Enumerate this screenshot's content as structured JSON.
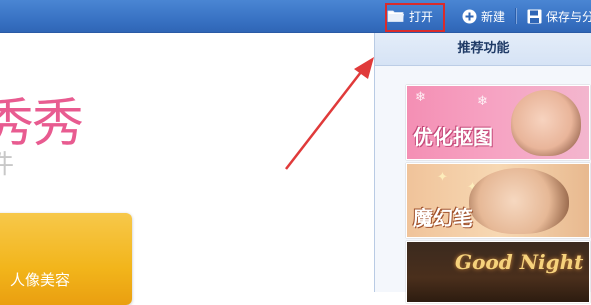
{
  "toolbar": {
    "open_label": "打开",
    "new_label": "新建",
    "save_label": "保存与分"
  },
  "canvas": {
    "brand_title": "秀秀",
    "brand_subtitle": "件",
    "portrait_tile_label": "人像美容"
  },
  "panel": {
    "title": "推荐功能",
    "cards": [
      {
        "label": "优化抠图"
      },
      {
        "label": "魔幻笔"
      },
      {
        "label": "Good Night"
      }
    ]
  },
  "colors": {
    "toolbar_blue": "#3a74c5",
    "highlight_red": "#d92b2b",
    "brand_pink": "#e85b90",
    "tile_yellow": "#f2b51b"
  }
}
